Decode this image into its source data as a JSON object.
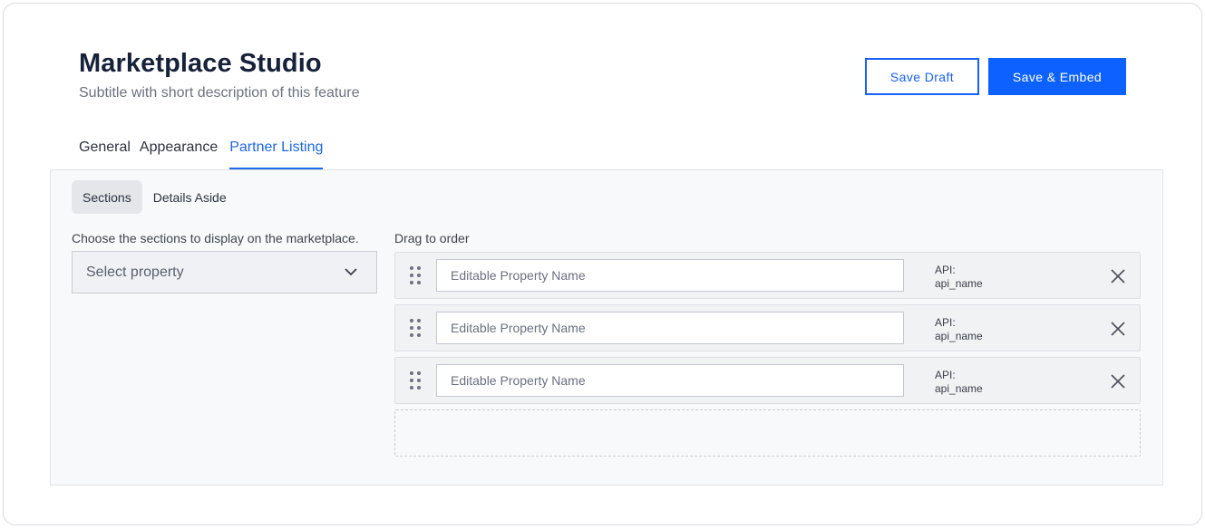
{
  "header": {
    "title": "Marketplace Studio",
    "subtitle": "Subtitle with short description of this feature"
  },
  "actions": {
    "save_draft": "Save Draft",
    "save_embed": "Save & Embed"
  },
  "tabs": [
    {
      "label": "General",
      "active": false
    },
    {
      "label": "Appearance",
      "active": false
    },
    {
      "label": "Partner Listing",
      "active": true
    }
  ],
  "subtabs": [
    {
      "label": "Sections",
      "active": true
    },
    {
      "label": "Details Aside",
      "active": false
    }
  ],
  "left": {
    "label": "Choose the sections to display on the marketplace.",
    "select_value": "Select property"
  },
  "right": {
    "label": "Drag to order",
    "rows": [
      {
        "placeholder": "Editable Property Name",
        "api_label": "API:",
        "api_name": "api_name"
      },
      {
        "placeholder": "Editable Property Name",
        "api_label": "API:",
        "api_name": "api_name"
      },
      {
        "placeholder": "Editable Property Name",
        "api_label": "API:",
        "api_name": "api_name"
      }
    ]
  },
  "icons": {
    "dropdown": "chevron-down-icon",
    "drag": "drag-handle-icon",
    "remove": "close-icon"
  },
  "colors": {
    "accent": "#0d62ff",
    "tab_active": "#1b67e8"
  }
}
